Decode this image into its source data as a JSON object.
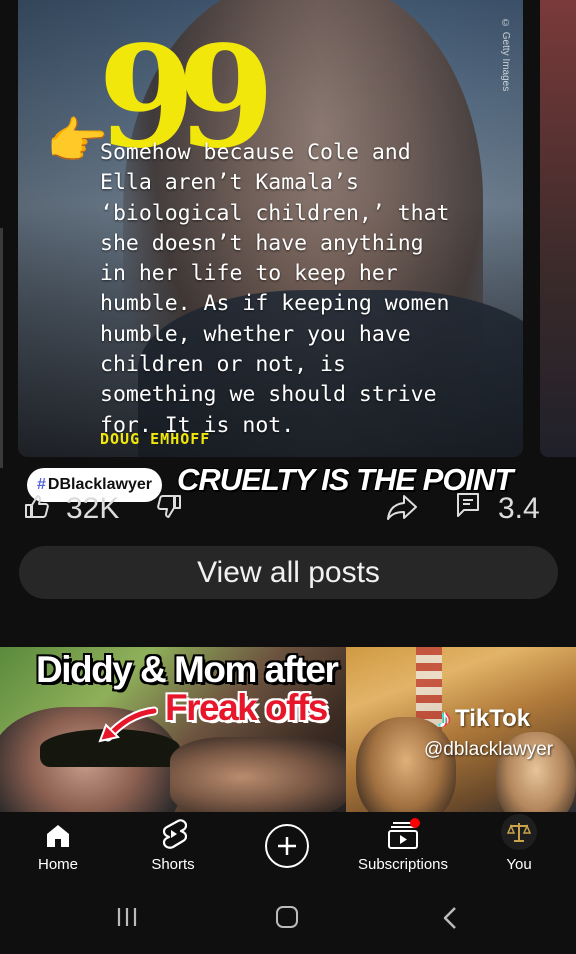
{
  "post": {
    "quote_mark": "99",
    "pointer_emoji": "👉",
    "quote_text": "Somehow because Cole and Ella aren’t Kamala’s ‘biological children,’ that she doesn’t have anything in her life to keep her humble. As if keeping women humble, whether you have children or not, is something we should strive for. It is not.",
    "attribution": "DOUG EMHOFF",
    "watermark": "© Getty Images"
  },
  "overlay": {
    "hashtag_symbol": "#",
    "hashtag": "DBlacklawyer",
    "caption": "CRUELTY IS THE POINT"
  },
  "actions": {
    "like_count": "32K",
    "comment_count": "3.4"
  },
  "view_all_label": "View all posts",
  "video": {
    "title_line1": "Diddy & Mom after",
    "title_line2": "Freak offs",
    "tiktok_label": "TikTok",
    "tiktok_note": "♪",
    "tiktok_handle": "@dblacklawyer"
  },
  "bottom_nav": {
    "home": "Home",
    "shorts": "Shorts",
    "subscriptions": "Subscriptions",
    "you": "You"
  },
  "colors": {
    "background": "#0f0f0f",
    "quote_yellow": "#f2e70a",
    "pill_gray": "#272727",
    "notification_red": "#ff0000"
  }
}
